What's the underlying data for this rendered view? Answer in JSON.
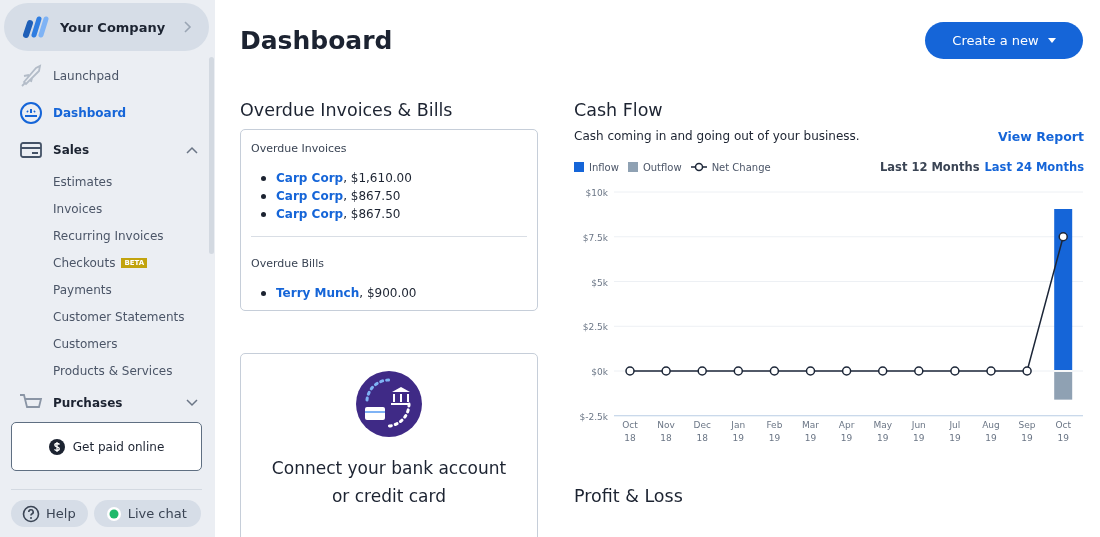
{
  "company": {
    "name": "Your Company"
  },
  "sidebar": {
    "items": [
      {
        "label": "Launchpad",
        "kind": "link",
        "selected": false
      },
      {
        "label": "Dashboard",
        "kind": "link",
        "selected": true
      },
      {
        "label": "Sales",
        "kind": "group",
        "selected": false,
        "expanded": true,
        "children": [
          {
            "label": "Estimates"
          },
          {
            "label": "Invoices"
          },
          {
            "label": "Recurring Invoices"
          },
          {
            "label": "Checkouts",
            "badge": "BETA"
          },
          {
            "label": "Payments"
          },
          {
            "label": "Customer Statements"
          },
          {
            "label": "Customers"
          },
          {
            "label": "Products & Services"
          }
        ]
      },
      {
        "label": "Purchases",
        "kind": "group",
        "selected": false,
        "expanded": false
      }
    ],
    "get_paid_button": "Get paid online",
    "help_button": "Help",
    "live_chat_button": "Live chat"
  },
  "page": {
    "title": "Dashboard",
    "create_button": "Create a new"
  },
  "overdue": {
    "title": "Overdue Invoices & Bills",
    "sections": [
      {
        "title": "Overdue Invoices",
        "items": [
          {
            "name": "Carp Corp",
            "amount": ", $1,610.00"
          },
          {
            "name": "Carp Corp",
            "amount": ", $867.50"
          },
          {
            "name": "Carp Corp",
            "amount": ", $867.50"
          }
        ]
      },
      {
        "title": "Overdue Bills",
        "items": [
          {
            "name": "Terry Munch",
            "amount": ", $900.00"
          }
        ]
      }
    ]
  },
  "connect_card": {
    "title": "Connect your bank account or credit card"
  },
  "cash_flow": {
    "title": "Cash Flow",
    "subtitle": "Cash coming in and going out of your business.",
    "view_report": "View Report",
    "ranges": [
      {
        "label": "Last 12 Months",
        "selected": true
      },
      {
        "label": "Last 24 Months",
        "selected": false
      }
    ],
    "chart_data": {
      "type": "bar",
      "stacked": true,
      "grid": true,
      "categories": [
        "Oct 18",
        "Nov 18",
        "Dec 18",
        "Jan 19",
        "Feb 19",
        "Mar 19",
        "Apr 19",
        "May 19",
        "Jun 19",
        "Jul 19",
        "Aug 19",
        "Sep 19",
        "Oct 19"
      ],
      "series": [
        {
          "name": "Inflow",
          "color": "#1565d8",
          "values": [
            0,
            0,
            0,
            0,
            0,
            0,
            0,
            0,
            0,
            0,
            0,
            0,
            9050
          ]
        },
        {
          "name": "Outflow",
          "color": "#8fa1b3",
          "values": [
            0,
            0,
            0,
            0,
            0,
            0,
            0,
            0,
            0,
            0,
            0,
            0,
            -1600
          ]
        },
        {
          "name": "Net Change",
          "type": "line",
          "marker": "circle",
          "color": "#1c2638",
          "values": [
            0,
            0,
            0,
            0,
            0,
            0,
            0,
            0,
            0,
            0,
            0,
            0,
            7500
          ]
        }
      ],
      "ylim": [
        -2500,
        10000
      ],
      "yticks": [
        {
          "value": 10000,
          "label": "$10k"
        },
        {
          "value": 7500,
          "label": "$7.5k"
        },
        {
          "value": 5000,
          "label": "$5k"
        },
        {
          "value": 2500,
          "label": "$2.5k"
        },
        {
          "value": 0,
          "label": "$0k"
        },
        {
          "value": -2500,
          "label": "$-2.5k"
        }
      ]
    }
  },
  "profit_loss": {
    "title": "Profit & Loss"
  }
}
